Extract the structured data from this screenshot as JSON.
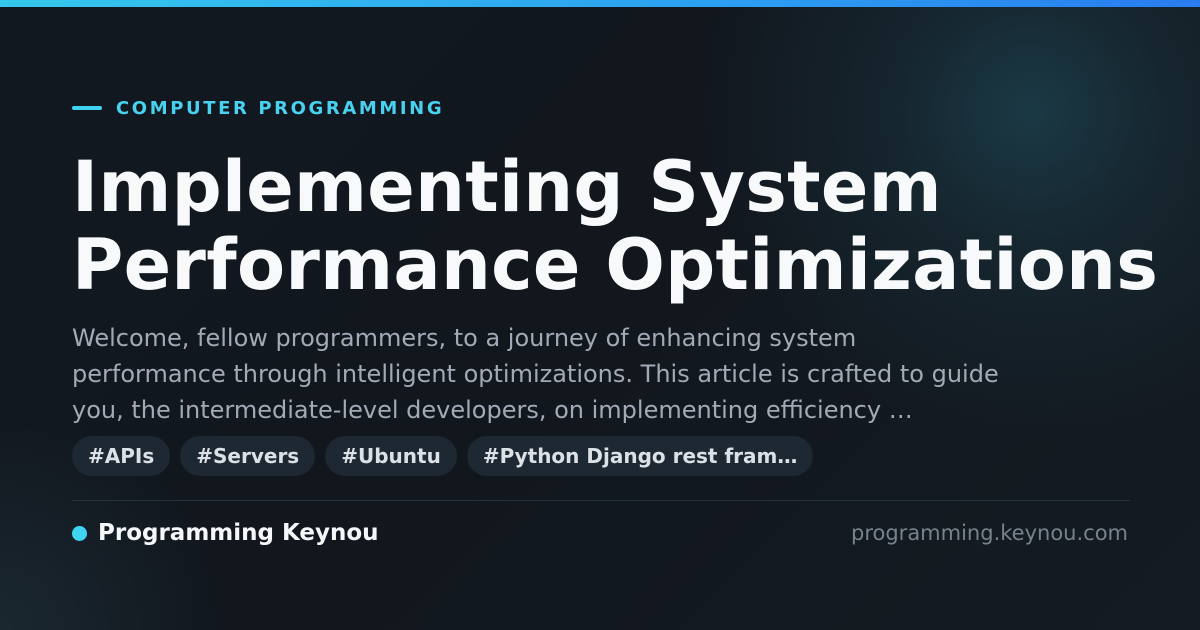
{
  "header": {
    "category": "COMPUTER PROGRAMMING"
  },
  "article": {
    "title_lines": [
      "Implementing System",
      "Performance Optimizations"
    ],
    "excerpt_lines": [
      "Welcome, fellow programmers, to a journey of enhancing system",
      "performance through intelligent optimizations. This article is crafted to guide",
      "you, the intermediate-level developers, on implementing efficiency …"
    ],
    "tags": [
      "#APIs",
      "#Servers",
      "#Ubuntu",
      "#Python Django rest fram…"
    ]
  },
  "footer": {
    "site_name": "Programming Keynou",
    "domain": "programming.keynou.com"
  },
  "colors": {
    "accent": "#3fd4f2",
    "background": "#11161d",
    "title": "#f7f9fb",
    "excerpt": "#a1aab5",
    "tag_background": "#1e2832"
  }
}
